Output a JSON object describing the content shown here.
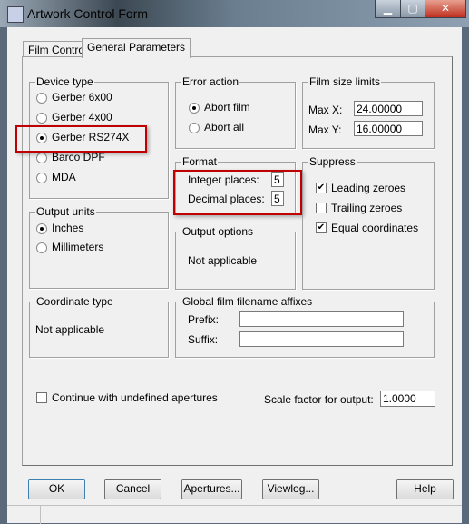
{
  "window": {
    "title": "Artwork Control Form",
    "minimize": "▁",
    "maximize": "▢",
    "close": "✕"
  },
  "tabs": [
    {
      "label": "Film Control",
      "active": false
    },
    {
      "label": "General Parameters",
      "active": true
    }
  ],
  "device_type": {
    "legend": "Device type",
    "options": [
      "Gerber 6x00",
      "Gerber 4x00",
      "Gerber RS274X",
      "Barco DPF",
      "MDA"
    ],
    "selected": "Gerber RS274X"
  },
  "output_units": {
    "legend": "Output units",
    "options": [
      "Inches",
      "Millimeters"
    ],
    "selected": "Inches"
  },
  "coordinate_type": {
    "legend": "Coordinate type",
    "text": "Not applicable"
  },
  "error_action": {
    "legend": "Error action",
    "options": [
      "Abort film",
      "Abort all"
    ],
    "selected": "Abort film"
  },
  "film_size": {
    "legend": "Film size limits",
    "max_x_label": "Max X:",
    "max_x": "24.00000",
    "max_y_label": "Max Y:",
    "max_y": "16.00000"
  },
  "format": {
    "legend": "Format",
    "integer_label": "Integer places:",
    "integer": "5",
    "decimal_label": "Decimal places:",
    "decimal": "5"
  },
  "output_options": {
    "legend": "Output options",
    "text": "Not applicable"
  },
  "suppress": {
    "legend": "Suppress",
    "items": [
      {
        "label": "Leading zeroes",
        "checked": true
      },
      {
        "label": "Trailing zeroes",
        "checked": false
      },
      {
        "label": "Equal coordinates",
        "checked": true
      }
    ]
  },
  "affixes": {
    "legend": "Global film filename affixes",
    "prefix_label": "Prefix:",
    "prefix": "",
    "suffix_label": "Suffix:",
    "suffix": ""
  },
  "continue": {
    "label": "Continue with undefined apertures",
    "checked": false
  },
  "scale": {
    "label": "Scale factor for output:",
    "value": "1.0000"
  },
  "buttons": {
    "ok": "OK",
    "cancel": "Cancel",
    "apertures": "Apertures...",
    "viewlog": "Viewlog...",
    "help": "Help"
  },
  "highlight_color": "#c00000"
}
